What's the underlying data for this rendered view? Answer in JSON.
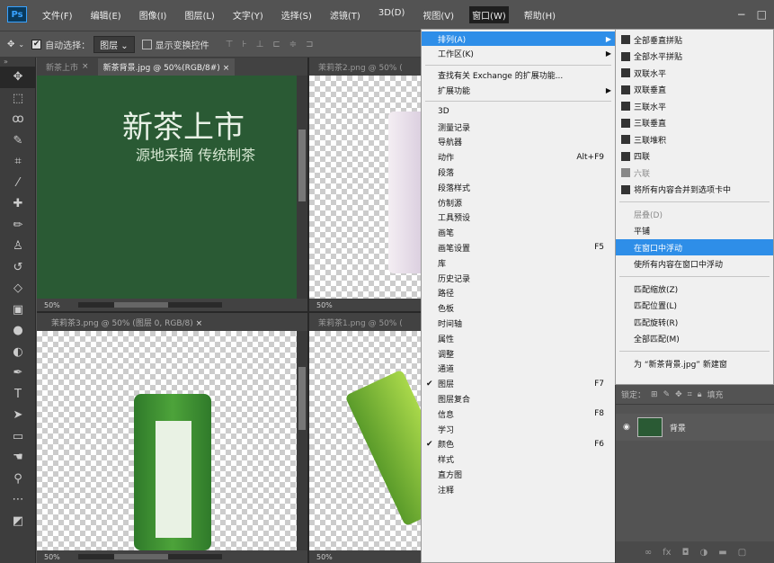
{
  "app": {
    "logo": "Ps"
  },
  "menubar": {
    "items": [
      "文件(F)",
      "编辑(E)",
      "图像(I)",
      "图层(L)",
      "文字(Y)",
      "选择(S)",
      "滤镜(T)",
      "3D(D)",
      "视图(V)",
      "窗口(W)",
      "帮助(H)"
    ],
    "active_index": 9
  },
  "window_controls": {
    "minimize": "−",
    "restore": "□"
  },
  "options": {
    "auto_select_label": "自动选择：",
    "auto_select_value": "图层",
    "transform_controls_label": "显示变换控件"
  },
  "documents": [
    {
      "tab_inactive": "新茶上市",
      "tab_active": "新茶背景.jpg @ 50%(RGB/8#)",
      "zoom": "50%",
      "heading": "新茶上市",
      "subheading": "源地采摘 传统制茶"
    },
    {
      "tab_active": "茉莉茶2.png @ 50% (",
      "zoom": "50%"
    },
    {
      "tab_active": "茉莉茶3.png @ 50% (图层 0, RGB/8)",
      "zoom": "50%"
    },
    {
      "tab_active": "茉莉茶1.png @ 50% (",
      "zoom": "50%"
    }
  ],
  "window_menu": {
    "items": [
      {
        "label": "排列(A)",
        "submenu": true,
        "highlight": true
      },
      {
        "label": "工作区(K)",
        "submenu": true
      },
      {
        "sep": true
      },
      {
        "label": "查找有关 Exchange 的扩展功能..."
      },
      {
        "label": "扩展功能",
        "submenu": true
      },
      {
        "sep": true
      },
      {
        "label": "3D"
      },
      {
        "label": "测量记录"
      },
      {
        "label": "导航器"
      },
      {
        "label": "动作",
        "shortcut": "Alt+F9"
      },
      {
        "label": "段落"
      },
      {
        "label": "段落样式"
      },
      {
        "label": "仿制源"
      },
      {
        "label": "工具预设"
      },
      {
        "label": "画笔"
      },
      {
        "label": "画笔设置",
        "shortcut": "F5"
      },
      {
        "label": "库"
      },
      {
        "label": "历史记录"
      },
      {
        "label": "路径"
      },
      {
        "label": "色板"
      },
      {
        "label": "时间轴"
      },
      {
        "label": "属性"
      },
      {
        "label": "调整"
      },
      {
        "label": "通道"
      },
      {
        "label": "图层",
        "shortcut": "F7",
        "checked": true
      },
      {
        "label": "图层复合"
      },
      {
        "label": "信息",
        "shortcut": "F8"
      },
      {
        "label": "学习"
      },
      {
        "label": "颜色",
        "shortcut": "F6",
        "checked": true
      },
      {
        "label": "样式"
      },
      {
        "label": "直方图"
      },
      {
        "label": "注释"
      }
    ]
  },
  "arrange_menu": {
    "items": [
      {
        "label": "全部垂直拼贴",
        "icon": true
      },
      {
        "label": "全部水平拼贴",
        "icon": true
      },
      {
        "label": "双联水平",
        "icon": true
      },
      {
        "label": "双联垂直",
        "icon": true
      },
      {
        "label": "三联水平",
        "icon": true
      },
      {
        "label": "三联垂直",
        "icon": true
      },
      {
        "label": "三联堆积",
        "icon": true
      },
      {
        "label": "四联",
        "icon": true
      },
      {
        "label": "六联",
        "icon": true,
        "disabled": true
      },
      {
        "label": "将所有内容合并到选项卡中",
        "icon": true
      },
      {
        "sep": true
      },
      {
        "label": "层叠(D)",
        "disabled": true
      },
      {
        "label": "平铺"
      },
      {
        "label": "在窗口中浮动",
        "highlight": true
      },
      {
        "label": "使所有内容在窗口中浮动"
      },
      {
        "sep": true
      },
      {
        "label": "匹配缩放(Z)"
      },
      {
        "label": "匹配位置(L)"
      },
      {
        "label": "匹配旋转(R)"
      },
      {
        "label": "全部匹配(M)"
      },
      {
        "sep": true
      },
      {
        "label": "为 “新茶背景.jpg” 新建窗"
      }
    ]
  },
  "layers": {
    "lock_label": "锁定：",
    "fill_label": "填充",
    "layer_name": "背景"
  }
}
